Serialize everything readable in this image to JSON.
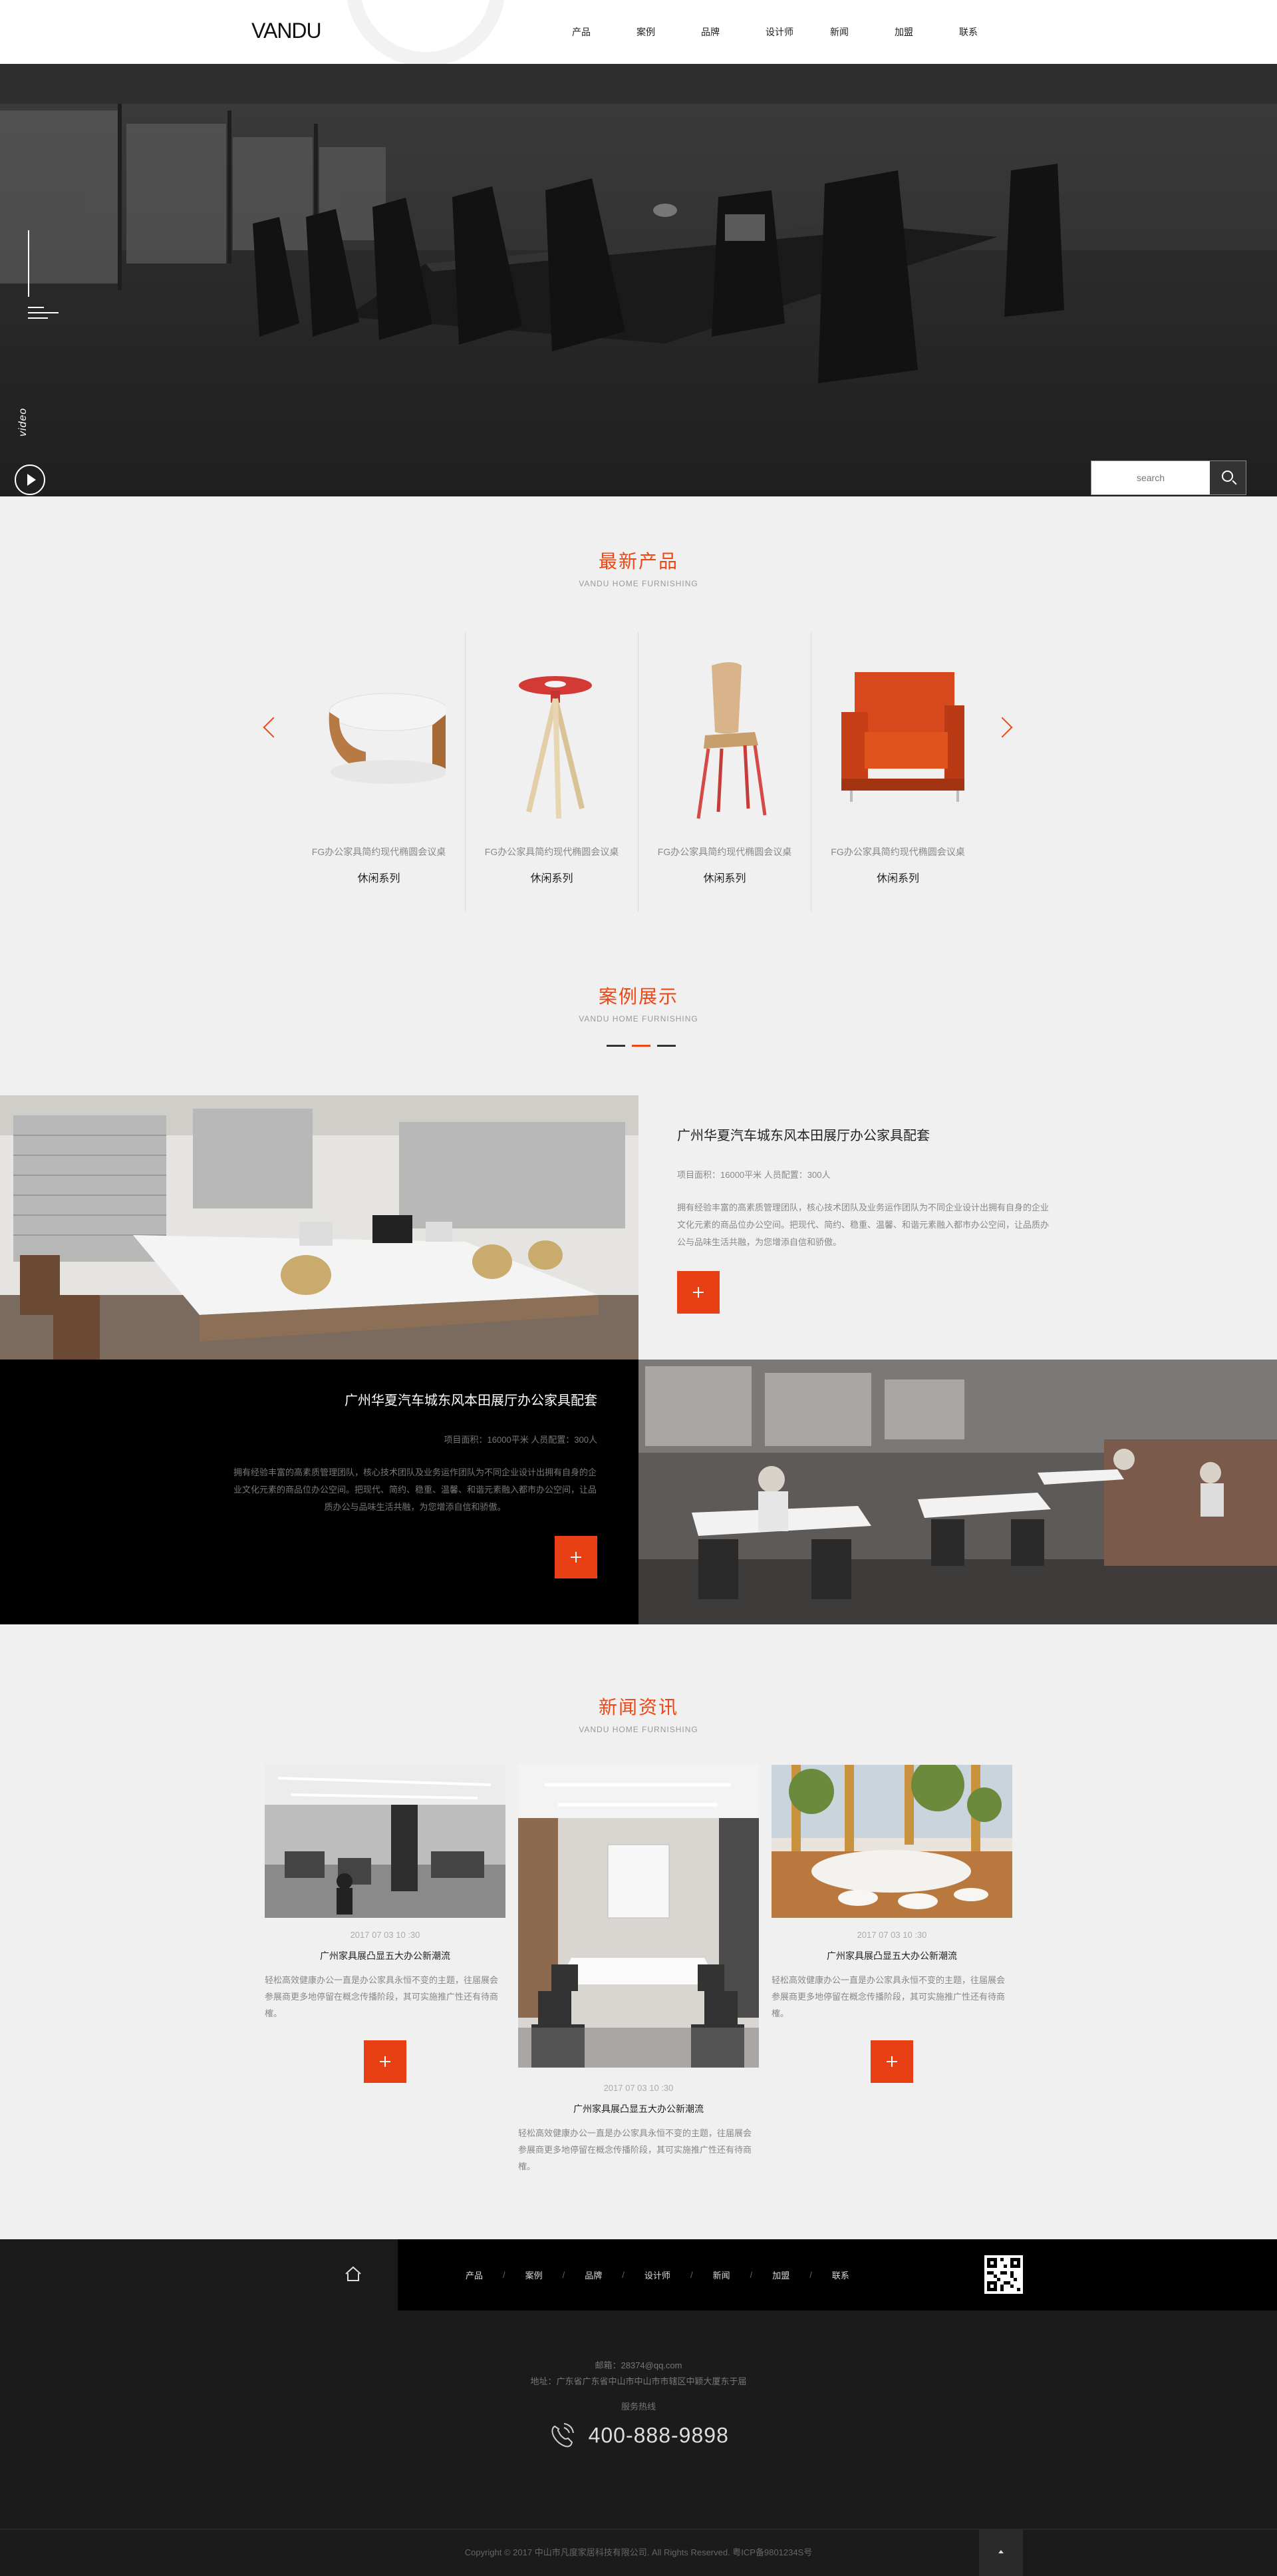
{
  "header": {
    "logo": "VANDU",
    "nav": [
      "产品",
      "案例",
      "品牌",
      "设计师",
      "新闻",
      "加盟",
      "联系"
    ]
  },
  "hero": {
    "video_label": "video",
    "search_placeholder": "search"
  },
  "products": {
    "title": "最新产品",
    "subtitle": "VANDU HOME FURNISHING",
    "items": [
      {
        "caption": "FG办公家具简约现代椭圆会议桌",
        "series": "休闲系列",
        "icon": "round-table-icon"
      },
      {
        "caption": "FG办公家具简约现代椭圆会议桌",
        "series": "休闲系列",
        "icon": "stool-icon"
      },
      {
        "caption": "FG办公家具简约现代椭圆会议桌",
        "series": "休闲系列",
        "icon": "chair-icon"
      },
      {
        "caption": "FG办公家具简约现代椭圆会议桌",
        "series": "休闲系列",
        "icon": "armchair-icon"
      }
    ]
  },
  "cases": {
    "title": "案例展示",
    "subtitle": "VANDU HOME FURNISHING",
    "items": [
      {
        "title": "广州华夏汽车城东风本田展厅办公家具配套",
        "meta": "项目面积：16000平米    人员配置：300人",
        "desc": "拥有经验丰富的高素质管理团队，核心技术团队及业务运作团队为不同企业设计出拥有自身的企业文化元素的商品位办公空间。把现代、简约、稳重、温馨、和谐元素融入都市办公空间，让品质办公与品味生活共融，为您增添自信和骄傲。"
      },
      {
        "title": "广州华夏汽车城东风本田展厅办公家具配套",
        "meta": "项目面积：16000平米    人员配置：300人",
        "desc": "拥有经验丰富的高素质管理团队，核心技术团队及业务运作团队为不同企业设计出拥有自身的企业文化元素的商品位办公空间。把现代、简约、稳重、温馨、和谐元素融入都市办公空间，让品质办公与品味生活共融，为您增添自信和骄傲。"
      }
    ]
  },
  "news": {
    "title": "新闻资讯",
    "subtitle": "VANDU HOME FURNISHING",
    "items": [
      {
        "date": "2017 07 03 10 :30",
        "title": "广州家具展凸显五大办公新潮流",
        "desc": "轻松高效健康办公一直是办公家具永恒不变的主题，往届展会参展商更多地停留在概念传播阶段，其可实施推广性还有待商榷。"
      },
      {
        "date": "2017 07 03 10 :30",
        "title": "广州家具展凸显五大办公新潮流",
        "desc": "轻松高效健康办公一直是办公家具永恒不变的主题，往届展会参展商更多地停留在概念传播阶段，其可实施推广性还有待商榷。"
      },
      {
        "date": "2017 07 03 10 :30",
        "title": "广州家具展凸显五大办公新潮流",
        "desc": "轻松高效健康办公一直是办公家具永恒不变的主题，往届展会参展商更多地停留在概念传播阶段，其可实施推广性还有待商榷。"
      }
    ]
  },
  "footer": {
    "nav": [
      "产品",
      "案例",
      "品牌",
      "设计师",
      "新闻",
      "加盟",
      "联系"
    ],
    "separator": "/",
    "email": "邮箱：28374@qq.com",
    "address": "地址：广东省广东省中山市中山市市辖区中颖大厦东于届",
    "hotline_label": "服务热线",
    "hotline": "400-888-9898",
    "copyright": "Copyright © 2017 中山市凡度家居科技有限公司. All Rights Reserved.    粤ICP备9801234S号"
  },
  "colors": {
    "accent": "#ee4716",
    "footer_bg": "#1b1b1b"
  }
}
